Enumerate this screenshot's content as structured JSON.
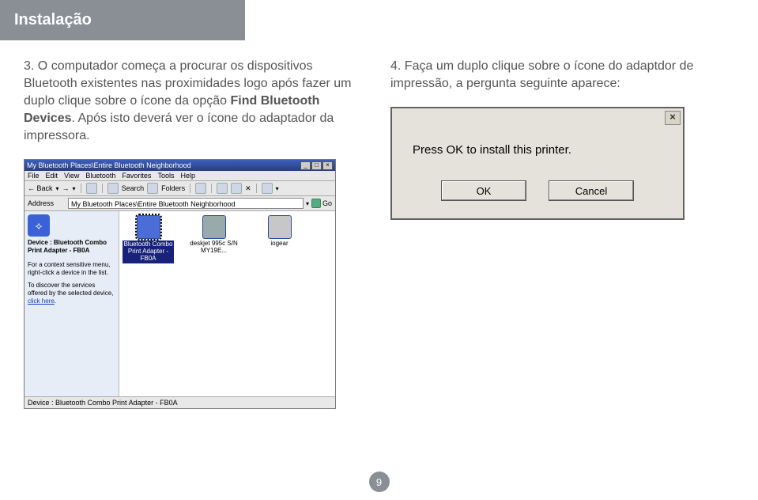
{
  "header": {
    "title": "Instalação"
  },
  "left": {
    "num": "3.",
    "text_before_bold": "O computador começa a procurar os dispositivos Bluetooth existentes nas proximidades logo após fazer um duplo clique sobre o ícone da opção ",
    "bold": "Find Bluetooth Devices",
    "text_after_bold": ". Após isto deverá ver o ícone do adaptador da impressora."
  },
  "right": {
    "num": "4.",
    "text": "Faça um duplo clique sobre o ícone do adaptdor de impressão, a pergunta seguinte aparece:"
  },
  "explorer": {
    "title": "My Bluetooth Places\\Entire Bluetooth Neighborhood",
    "menus": [
      "File",
      "Edit",
      "View",
      "Bluetooth",
      "Favorites",
      "Tools",
      "Help"
    ],
    "toolbar": {
      "back": "Back",
      "search": "Search",
      "folders": "Folders"
    },
    "address_label": "Address",
    "address_value": "My Bluetooth Places\\Entire Bluetooth Neighborhood",
    "go": "Go",
    "side": {
      "device_line": "Device : Bluetooth Combo Print Adapter - FB0A",
      "hint1": "For a context sensitive menu, right-click a device in the list.",
      "hint2": "To discover the services offered by the selected device,",
      "link": "click here"
    },
    "items": [
      {
        "label": "Bluetooth Combo Print Adapter - FB0A",
        "selected": true
      },
      {
        "label": "deskjet 995c S/N MY19E...",
        "selected": false
      },
      {
        "label": "iogear",
        "selected": false
      }
    ],
    "status": "Device : Bluetooth Combo Print Adapter - FB0A"
  },
  "dialog": {
    "message": "Press OK to install this printer.",
    "ok": "OK",
    "cancel": "Cancel"
  },
  "page_number": "9"
}
